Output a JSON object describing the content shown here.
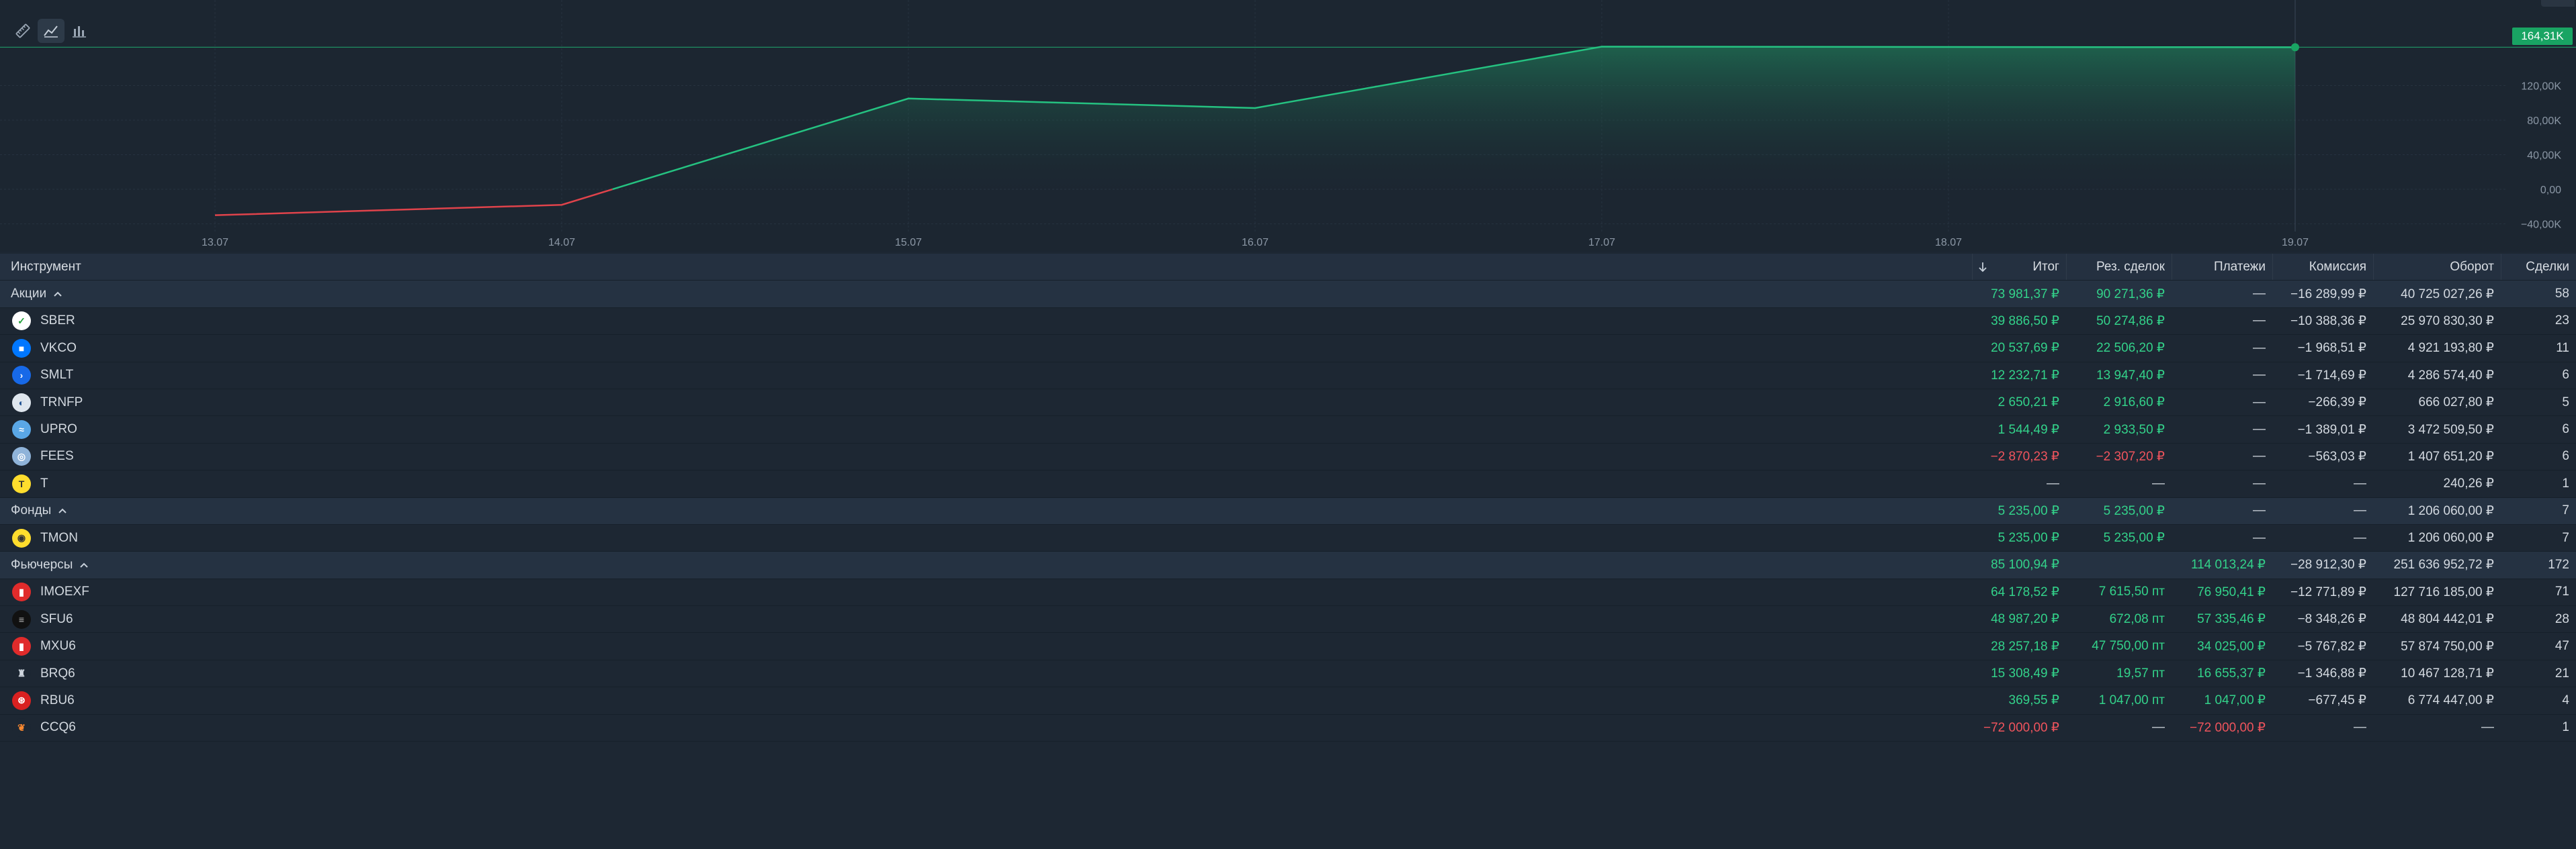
{
  "chart": {
    "current_value_label": "164,31K",
    "y_ticks": [
      "120,00K",
      "80,00K",
      "40,00K",
      "0,00",
      "−40,00K"
    ],
    "x_ticks": [
      "13.07",
      "14.07",
      "15.07",
      "16.07",
      "17.07",
      "18.07",
      "19.07"
    ],
    "icons": [
      "ruler-icon",
      "line-chart-icon",
      "bar-chart-icon"
    ],
    "colors": {
      "positive": "#25c281",
      "negative": "#e0434b",
      "accent": "#19a463"
    }
  },
  "chart_data": {
    "type": "area",
    "x": [
      "13.07",
      "14.07",
      "15.07",
      "16.07",
      "17.07",
      "18.07",
      "19.07"
    ],
    "points": [
      {
        "x": "13.07",
        "y": -30000
      },
      {
        "x": "14.07",
        "y": -18000
      },
      {
        "x": "15.07",
        "y": 105000
      },
      {
        "x": "16.07",
        "y": 94000
      },
      {
        "x": "17.07",
        "y": 165000
      },
      {
        "x": "19.07",
        "y": 164310
      }
    ],
    "y_ticks": [
      -40000,
      0,
      40000,
      80000,
      120000
    ],
    "ylim": [
      -45000,
      205000
    ],
    "grid": true,
    "last_value": "164,31K"
  },
  "table": {
    "columns": {
      "instrument": "Инструмент",
      "total": "Итог",
      "deals_result": "Рез. сделок",
      "payments": "Платежи",
      "commission": "Комиссия",
      "turnover": "Оборот",
      "deals": "Сделки"
    },
    "rows": [
      {
        "kind": "group",
        "name": "Акции",
        "total": "73 981,37 ₽",
        "total_c": "pos",
        "res": "90 271,36 ₽",
        "res_c": "pos",
        "pay": "—",
        "pay_c": "neu",
        "comm": "−16 289,99 ₽",
        "comm_c": "neu",
        "turn": "40 725 027,26 ₽",
        "deals": "58"
      },
      {
        "kind": "item",
        "name": "SBER",
        "logo": "sber-logo-icon",
        "total": "39 886,50 ₽",
        "total_c": "pos",
        "res": "50 274,86 ₽",
        "res_c": "pos",
        "pay": "—",
        "pay_c": "neu",
        "comm": "−10 388,36 ₽",
        "comm_c": "neu",
        "turn": "25 970 830,30 ₽",
        "deals": "23"
      },
      {
        "kind": "item",
        "name": "VKCO",
        "logo": "vkco-logo-icon",
        "total": "20 537,69 ₽",
        "total_c": "pos",
        "res": "22 506,20 ₽",
        "res_c": "pos",
        "pay": "—",
        "pay_c": "neu",
        "comm": "−1 968,51 ₽",
        "comm_c": "neu",
        "turn": "4 921 193,80 ₽",
        "deals": "11"
      },
      {
        "kind": "item",
        "name": "SMLT",
        "logo": "smlt-logo-icon",
        "total": "12 232,71 ₽",
        "total_c": "pos",
        "res": "13 947,40 ₽",
        "res_c": "pos",
        "pay": "—",
        "pay_c": "neu",
        "comm": "−1 714,69 ₽",
        "comm_c": "neu",
        "turn": "4 286 574,40 ₽",
        "deals": "6"
      },
      {
        "kind": "item",
        "name": "TRNFP",
        "logo": "trnfp-logo-icon",
        "total": "2 650,21 ₽",
        "total_c": "pos",
        "res": "2 916,60 ₽",
        "res_c": "pos",
        "pay": "—",
        "pay_c": "neu",
        "comm": "−266,39 ₽",
        "comm_c": "neu",
        "turn": "666 027,80 ₽",
        "deals": "5"
      },
      {
        "kind": "item",
        "name": "UPRO",
        "logo": "upro-logo-icon",
        "total": "1 544,49 ₽",
        "total_c": "pos",
        "res": "2 933,50 ₽",
        "res_c": "pos",
        "pay": "—",
        "pay_c": "neu",
        "comm": "−1 389,01 ₽",
        "comm_c": "neu",
        "turn": "3 472 509,50 ₽",
        "deals": "6"
      },
      {
        "kind": "item",
        "name": "FEES",
        "logo": "fees-logo-icon",
        "total": "−2 870,23 ₽",
        "total_c": "neg",
        "res": "−2 307,20 ₽",
        "res_c": "neg",
        "pay": "—",
        "pay_c": "neu",
        "comm": "−563,03 ₽",
        "comm_c": "neu",
        "turn": "1 407 651,20 ₽",
        "deals": "6"
      },
      {
        "kind": "item",
        "name": "T",
        "logo": "t-logo-icon",
        "total": "—",
        "total_c": "neu",
        "res": "—",
        "res_c": "neu",
        "pay": "—",
        "pay_c": "neu",
        "comm": "—",
        "comm_c": "neu",
        "turn": "240,26 ₽",
        "deals": "1"
      },
      {
        "kind": "group",
        "name": "Фонды",
        "total": "5 235,00 ₽",
        "total_c": "pos",
        "res": "5 235,00 ₽",
        "res_c": "pos",
        "pay": "—",
        "pay_c": "neu",
        "comm": "—",
        "comm_c": "neu",
        "turn": "1 206 060,00 ₽",
        "deals": "7"
      },
      {
        "kind": "item",
        "name": "TMON",
        "logo": "tmon-logo-icon",
        "total": "5 235,00 ₽",
        "total_c": "pos",
        "res": "5 235,00 ₽",
        "res_c": "pos",
        "pay": "—",
        "pay_c": "neu",
        "comm": "—",
        "comm_c": "neu",
        "turn": "1 206 060,00 ₽",
        "deals": "7"
      },
      {
        "kind": "group",
        "name": "Фьючерсы",
        "total": "85 100,94 ₽",
        "total_c": "pos",
        "res": "",
        "res_c": "neu",
        "pay": "114 013,24 ₽",
        "pay_c": "pos",
        "comm": "−28 912,30 ₽",
        "comm_c": "neu",
        "turn": "251 636 952,72 ₽",
        "deals": "172"
      },
      {
        "kind": "item",
        "name": "IMOEXF",
        "logo": "imoexf-logo-icon",
        "total": "64 178,52 ₽",
        "total_c": "pos",
        "res": "7 615,50 пт",
        "res_c": "pos",
        "pay": "76 950,41 ₽",
        "pay_c": "pos",
        "comm": "−12 771,89 ₽",
        "comm_c": "neu",
        "turn": "127 716 185,00 ₽",
        "deals": "71"
      },
      {
        "kind": "item",
        "name": "SFU6",
        "logo": "sfu6-logo-icon",
        "total": "48 987,20 ₽",
        "total_c": "pos",
        "res": "672,08 пт",
        "res_c": "pos",
        "pay": "57 335,46 ₽",
        "pay_c": "pos",
        "comm": "−8 348,26 ₽",
        "comm_c": "neu",
        "turn": "48 804 442,01 ₽",
        "deals": "28"
      },
      {
        "kind": "item",
        "name": "MXU6",
        "logo": "mxu6-logo-icon",
        "total": "28 257,18 ₽",
        "total_c": "pos",
        "res": "47 750,00 пт",
        "res_c": "pos",
        "pay": "34 025,00 ₽",
        "pay_c": "pos",
        "comm": "−5 767,82 ₽",
        "comm_c": "neu",
        "turn": "57 874 750,00 ₽",
        "deals": "47"
      },
      {
        "kind": "item",
        "name": "BRQ6",
        "logo": "brq6-logo-icon",
        "total": "15 308,49 ₽",
        "total_c": "pos",
        "res": "19,57 пт",
        "res_c": "pos",
        "pay": "16 655,37 ₽",
        "pay_c": "pos",
        "comm": "−1 346,88 ₽",
        "comm_c": "neu",
        "turn": "10 467 128,71 ₽",
        "deals": "21"
      },
      {
        "kind": "item",
        "name": "RBU6",
        "logo": "rbu6-logo-icon",
        "total": "369,55 ₽",
        "total_c": "pos",
        "res": "1 047,00 пт",
        "res_c": "pos",
        "pay": "1 047,00 ₽",
        "pay_c": "pos",
        "comm": "−677,45 ₽",
        "comm_c": "neu",
        "turn": "6 774 447,00 ₽",
        "deals": "4"
      },
      {
        "kind": "item",
        "name": "CCQ6",
        "logo": "ccq6-logo-icon",
        "total": "−72 000,00 ₽",
        "total_c": "neg",
        "res": "—",
        "res_c": "neu",
        "pay": "−72 000,00 ₽",
        "pay_c": "neg",
        "comm": "—",
        "comm_c": "neu",
        "turn": "—",
        "deals": "1"
      }
    ]
  }
}
